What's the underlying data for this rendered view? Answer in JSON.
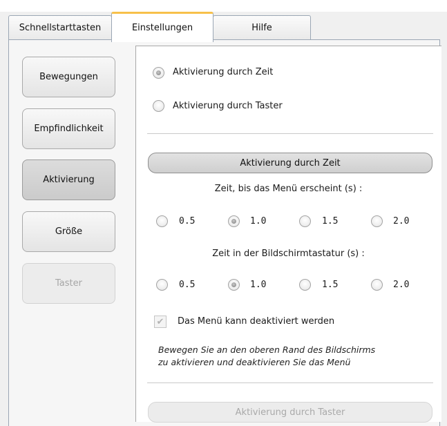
{
  "tabs": [
    "Schnellstarttasten",
    "Einstellungen",
    "Hilfe"
  ],
  "nav": {
    "items": [
      {
        "label": "Bewegungen",
        "state": "normal"
      },
      {
        "label": "Empfindlichkeit",
        "state": "normal"
      },
      {
        "label": "Aktivierung",
        "state": "selected"
      },
      {
        "label": "Größe",
        "state": "normal"
      },
      {
        "label": "Taster",
        "state": "disabled"
      }
    ]
  },
  "activation": {
    "mode_options": [
      "Aktivierung durch Zeit",
      "Aktivierung durch Taster"
    ],
    "selected_mode": "Aktivierung durch Zeit"
  },
  "time_section": {
    "header": "Aktivierung durch Zeit",
    "menu_delay_label": "Zeit, bis das Menü erscheint (s) :",
    "menu_delay_options": [
      "0.5",
      "1.0",
      "1.5",
      "2.0"
    ],
    "menu_delay_selected": "1.0",
    "keyboard_delay_label": "Zeit in der Bildschirmtastatur (s) :",
    "keyboard_delay_options": [
      "0.5",
      "1.0",
      "1.5",
      "2.0"
    ],
    "keyboard_delay_selected": "1.0",
    "deactivate_checkbox_label": "Das Menü kann deaktiviert werden",
    "deactivate_checked": true,
    "hint_line1": "Bewegen Sie an den oberen Rand des Bildschirms",
    "hint_line2": "zu aktivieren und deaktivieren Sie das Menü"
  },
  "button_section": {
    "header": "Aktivierung durch Taster"
  },
  "colors": {
    "active_tab_accent": "#f7c04a",
    "disabled_text": "#a6a6a6"
  }
}
